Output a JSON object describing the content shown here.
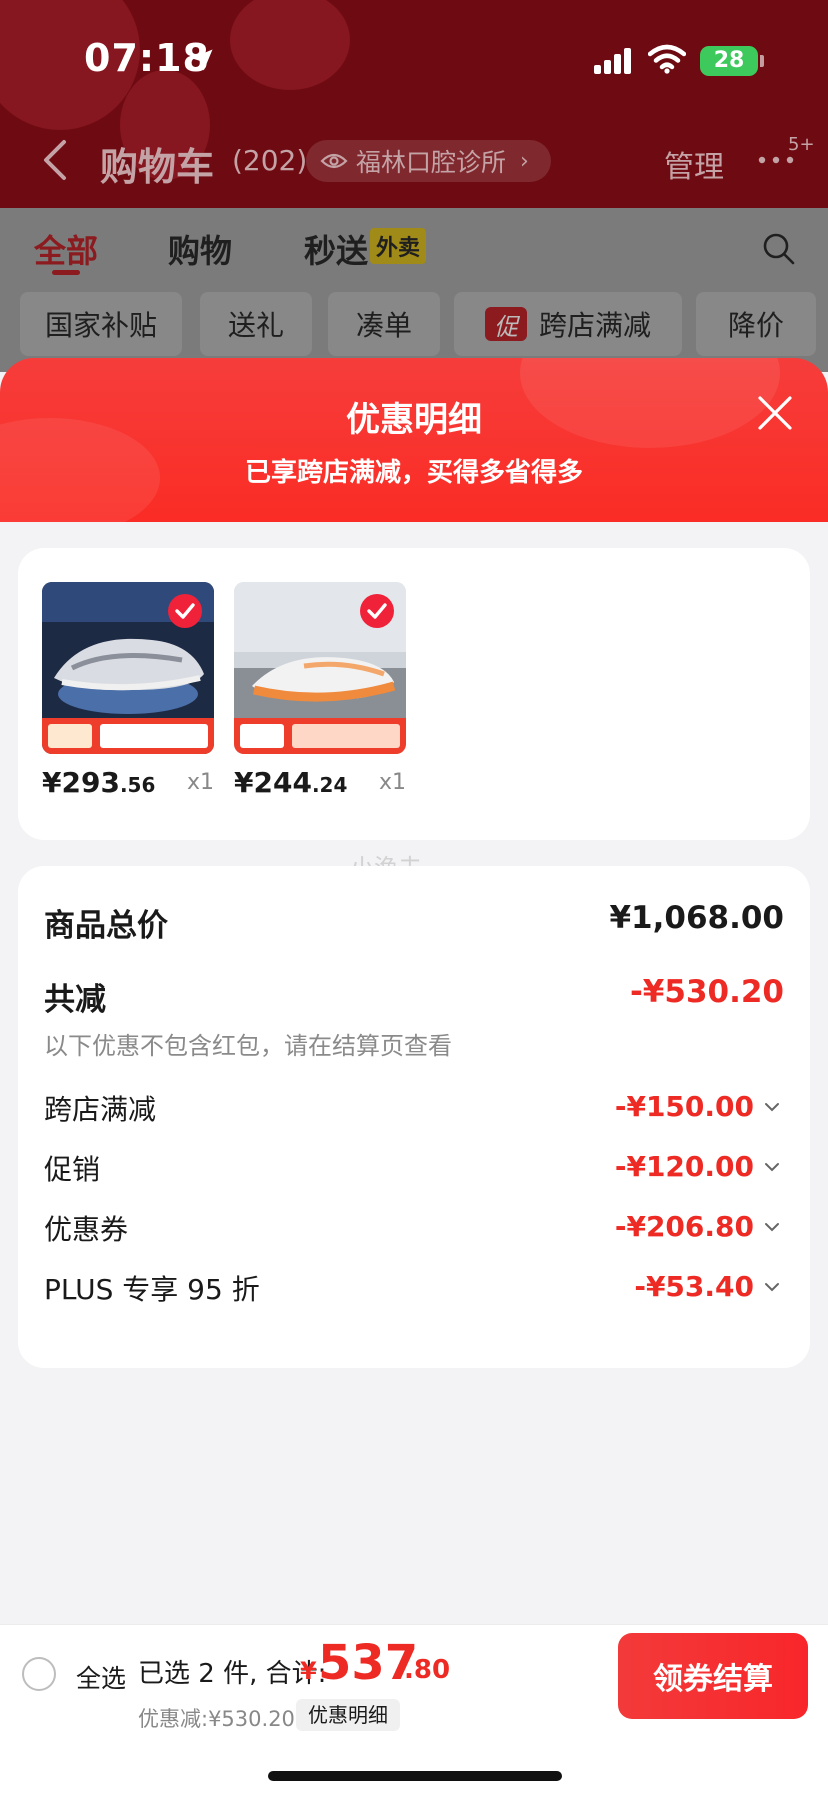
{
  "status_bar": {
    "time": "07:18",
    "battery": "28"
  },
  "nav": {
    "title": "购物车",
    "count": "(202)",
    "store": "福林口腔诊所",
    "manage": "管理",
    "more_badge": "5+"
  },
  "tabs": [
    {
      "label": "全部"
    },
    {
      "label": "购物"
    },
    {
      "label": "秒送"
    }
  ],
  "takeout_badge": "外卖",
  "filters": [
    "国家补贴",
    "送礼",
    "凑单",
    "跨店满减",
    "降价"
  ],
  "promo_tag": "促",
  "sheet": {
    "title": "优惠明细",
    "subtitle": "已享跨店满减，买得多省得多"
  },
  "products": [
    {
      "price_int": "¥293",
      "price_dec": ".56",
      "qty": "x1"
    },
    {
      "price_int": "¥244",
      "price_dec": ".24",
      "qty": "x1"
    }
  ],
  "watermark": "小渔夫",
  "summary": {
    "total_label": "商品总价",
    "total_value": "¥1,068.00",
    "reduce_label": "共减",
    "reduce_value": "-¥530.20",
    "note": "以下优惠不包含红包，请在结算页查看",
    "discounts": [
      {
        "label": "跨店满减",
        "value": "-¥150.00"
      },
      {
        "label": "促销",
        "value": "-¥120.00"
      },
      {
        "label": "优惠券",
        "value": "-¥206.80"
      },
      {
        "label": "PLUS 专享 95 折",
        "value": "-¥53.40"
      }
    ]
  },
  "bottom": {
    "select_all": "全选",
    "selected_text": "已选 2 件, 合计:",
    "currency": "¥",
    "total_int": "537",
    "total_dec": ".80",
    "discount_text": "优惠减:¥530.20",
    "detail_label": "优惠明细",
    "checkout_label": "领券结算"
  },
  "colors": {
    "accent_red": "#ee2a24",
    "header_red": "#f63d3b"
  }
}
